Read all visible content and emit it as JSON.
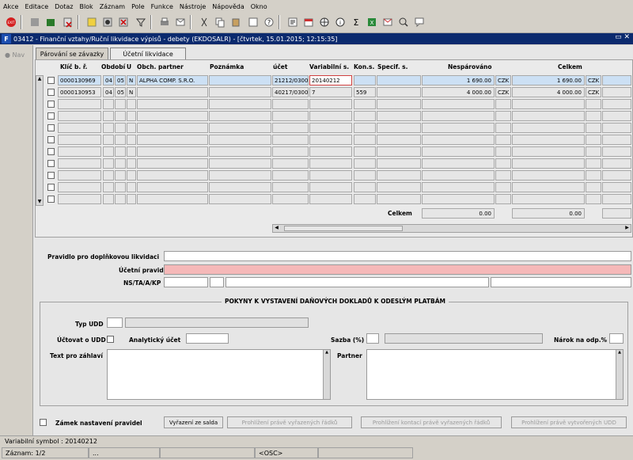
{
  "menu": [
    "Akce",
    "Editace",
    "Dotaz",
    "Blok",
    "Záznam",
    "Pole",
    "Funkce",
    "Nástroje",
    "Nápověda",
    "Okno"
  ],
  "toolbar_icons": [
    "exit-icon",
    "save-icon",
    "clear-icon",
    "delete-icon",
    "enter-query-icon",
    "execute-query-icon",
    "cancel-query-icon",
    "filter-icon",
    "print-icon",
    "mail-icon",
    "cut-icon",
    "copy-icon",
    "paste-icon",
    "edit-icon",
    "help-icon",
    "report-icon",
    "calendar-icon",
    "globe-icon",
    "info-icon",
    "sigma-icon",
    "excel-icon",
    "email-icon",
    "zoom-icon",
    "chat-icon"
  ],
  "window": {
    "title": "03412 - Finanční vztahy/Ruční likvidace výpisů - debety (EKDOSALR) - [čtvrtek, 15.01.2015; 12:15:35]",
    "logo": "F"
  },
  "nav": {
    "label": "Nav"
  },
  "tabs": [
    {
      "label": "Párování se závazky"
    },
    {
      "label": "Účetní likvidace"
    }
  ],
  "table": {
    "headers": {
      "klic": "Klíč b. ř.",
      "obdobi": "Období",
      "u": "U",
      "partner": "Obch. partner",
      "poznamka": "Poznámka",
      "ucet": "účet",
      "vs": "Variabilní s.",
      "ks": "Kon.s.",
      "ss": "Specif. s.",
      "nesparovano": "Nespárováno",
      "celkem": "Celkem"
    },
    "rows": [
      {
        "klic": "0000130969",
        "o1": "04",
        "o2": "05",
        "u": "N",
        "partner": "ALPHA COMP. S.R.O.",
        "poznamka": "",
        "ucet": "21212/0300",
        "vs": "20140212",
        "ks": "",
        "ss": "",
        "nesp": "1 690.00",
        "mena1": "CZK",
        "celkem": "1 690.00",
        "mena2": "CZK"
      },
      {
        "klic": "0000130953",
        "o1": "04",
        "o2": "05",
        "u": "N",
        "partner": "",
        "poznamka": "",
        "ucet": "40217/0300",
        "vs": "7",
        "ks": "559",
        "ss": "",
        "nesp": "4 000.00",
        "mena1": "CZK",
        "celkem": "4 000.00",
        "mena2": "CZK"
      }
    ],
    "empty_rows": 9,
    "footer_label": "Celkem",
    "footer_nesp": "0.00",
    "footer_celkem": "0.00"
  },
  "form": {
    "pravidlo_label": "Pravidlo pro doplňkovou likvidaci",
    "ucetni_label": "Účetní pravidlo",
    "ns_label": "NS/TA/A/KP",
    "section_title": "POKYNY K VYSTAVENÍ DAŇOVÝCH DOKLADŮ K ODESLÝM PLATBÁM",
    "typ_udd_label": "Typ UDD",
    "uctovat_label": "Účtovat o UDD",
    "analyticky_label": "Analytický účet",
    "sazba_label": "Sazba (%)",
    "narok_label": "Nárok na odp.%",
    "text_label": "Text pro záhlaví",
    "partner_label": "Partner",
    "zamek_label": "Zámek nastavení pravidel"
  },
  "buttons": {
    "vyrazeni": "Vyřazení ze salda",
    "prohlizeni1": "Prohlížení právě vyřazených řádků",
    "prohlizeni2": "Prohlížení kontací právě vyřazených řádků",
    "prohlizeni3": "Prohlížení právě vytvořených UDD"
  },
  "status": {
    "message": "Variabilní symbol : 20140212",
    "record": "Záznam: 1/2",
    "dots": "...",
    "mode": "<OSC>"
  }
}
